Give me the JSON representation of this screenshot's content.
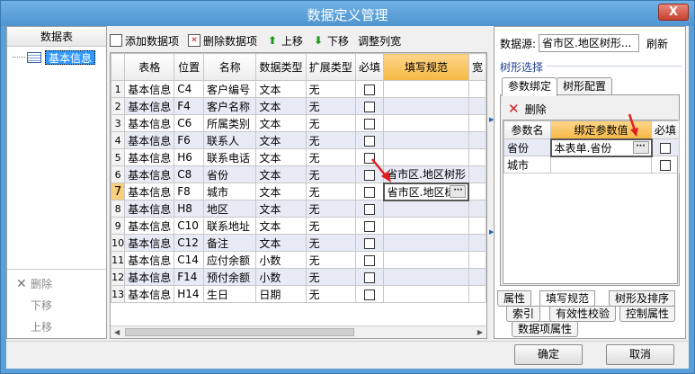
{
  "window": {
    "title": "数据定义管理",
    "close_glyph": "X"
  },
  "left_panel": {
    "header": "数据表",
    "tree_item": "基本信息",
    "actions": [
      {
        "label": "删除",
        "glyph": "✕"
      },
      {
        "label": "下移"
      },
      {
        "label": "上移"
      }
    ]
  },
  "toolbar": {
    "add": "添加数据项",
    "delete": "删除数据项",
    "up": "上移",
    "down": "下移",
    "adjust": "调整列宽"
  },
  "grid": {
    "headers": [
      "表格",
      "位置",
      "名称",
      "数据类型",
      "扩展类型",
      "必填",
      "填写规范",
      "宽"
    ],
    "rows": [
      {
        "n": "1",
        "table": "基本信息",
        "pos": "C4",
        "name": "客户编号",
        "type": "文本",
        "ext": "无",
        "rule": ""
      },
      {
        "n": "2",
        "table": "基本信息",
        "pos": "F4",
        "name": "客户名称",
        "type": "文本",
        "ext": "无",
        "rule": ""
      },
      {
        "n": "3",
        "table": "基本信息",
        "pos": "C6",
        "name": "所属类别",
        "type": "文本",
        "ext": "无",
        "rule": ""
      },
      {
        "n": "4",
        "table": "基本信息",
        "pos": "F6",
        "name": "联系人",
        "type": "文本",
        "ext": "无",
        "rule": ""
      },
      {
        "n": "5",
        "table": "基本信息",
        "pos": "H6",
        "name": "联系电话",
        "type": "文本",
        "ext": "无",
        "rule": ""
      },
      {
        "n": "6",
        "table": "基本信息",
        "pos": "C8",
        "name": "省份",
        "type": "文本",
        "ext": "无",
        "rule": "省市区.地区树形"
      },
      {
        "n": "7",
        "table": "基本信息",
        "pos": "F8",
        "name": "城市",
        "type": "文本",
        "ext": "无",
        "rule": "省市区.地区树"
      },
      {
        "n": "8",
        "table": "基本信息",
        "pos": "H8",
        "name": "地区",
        "type": "文本",
        "ext": "无",
        "rule": ""
      },
      {
        "n": "9",
        "table": "基本信息",
        "pos": "C10",
        "name": "联系地址",
        "type": "文本",
        "ext": "无",
        "rule": ""
      },
      {
        "n": "10",
        "table": "基本信息",
        "pos": "C12",
        "name": "备注",
        "type": "文本",
        "ext": "无",
        "rule": ""
      },
      {
        "n": "11",
        "table": "基本信息",
        "pos": "C14",
        "name": "应付余额",
        "type": "小数",
        "ext": "无",
        "rule": ""
      },
      {
        "n": "12",
        "table": "基本信息",
        "pos": "F14",
        "name": "预付余额",
        "type": "小数",
        "ext": "无",
        "rule": ""
      },
      {
        "n": "13",
        "table": "基本信息",
        "pos": "H14",
        "name": "生日",
        "type": "日期",
        "ext": "无",
        "rule": ""
      }
    ],
    "current_row_marker": "7",
    "ellipsis": "···"
  },
  "right_panel": {
    "datasource_label": "数据源:",
    "datasource_value": "省市区.地区树形...",
    "refresh": "刷新",
    "tree_select": "树形选择",
    "tabs": [
      "参数绑定",
      "树形配置"
    ],
    "delete": "删除",
    "param_headers": [
      "参数名",
      "绑定参数值",
      "必填"
    ],
    "params": [
      {
        "name": "省份",
        "value": "本表单.省份"
      },
      {
        "name": "城市",
        "value": ""
      }
    ],
    "ellipsis": "···",
    "bottom_tabs": {
      "row1": [
        "属性",
        "填写规范",
        "树形及排序"
      ],
      "row2": [
        "索引",
        "有效性校验",
        "控制属性"
      ],
      "row3": [
        "数据项属性"
      ]
    }
  },
  "footer": {
    "ok": "确定",
    "cancel": "取消"
  },
  "colors": {
    "title_bar": "#5aa0d8",
    "highlight_header": "#f5b843",
    "selection": "#3399ff",
    "annotation_arrow": "#e02020"
  }
}
